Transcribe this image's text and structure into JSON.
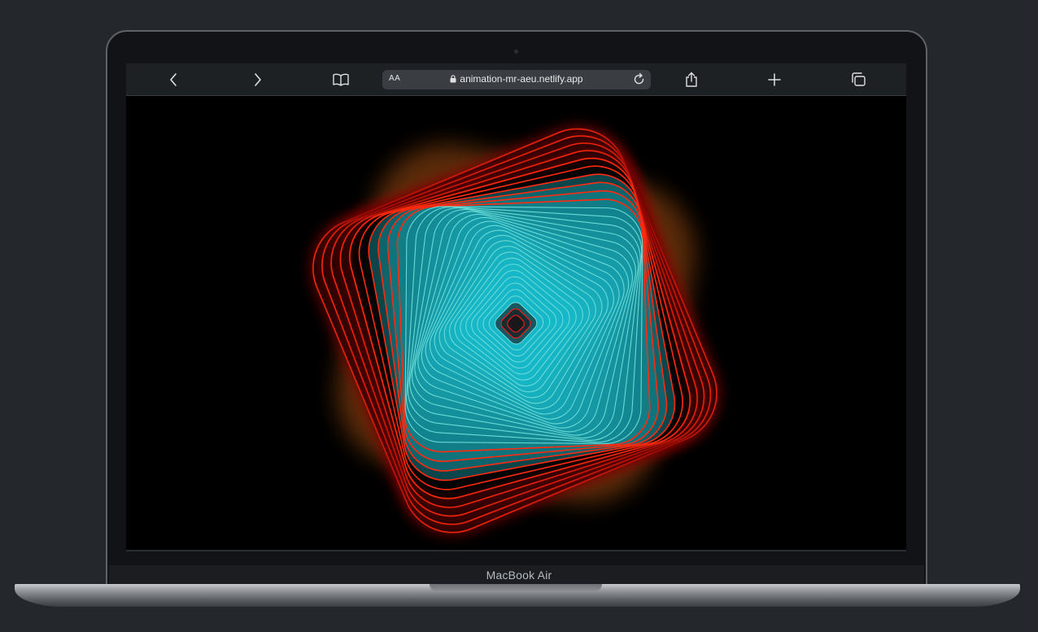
{
  "device": {
    "name": "MacBook Air"
  },
  "browser": {
    "reader_label": "AA",
    "url": "animation-mr-aeu.netlify.app",
    "icons": {
      "back": "chevron-left-icon",
      "forward": "chevron-right-icon",
      "bookmarks": "book-icon",
      "lock": "lock-icon",
      "reload": "reload-icon",
      "share": "share-icon",
      "new_tab": "plus-icon",
      "tabs": "tabs-icon"
    }
  },
  "animation": {
    "colors": {
      "outer_stroke": "#ff2a10",
      "glow": "#ff7a1a",
      "inner": "#18b8c8",
      "highlight": "#9ff0e0",
      "center": "#ff1a1a"
    }
  }
}
